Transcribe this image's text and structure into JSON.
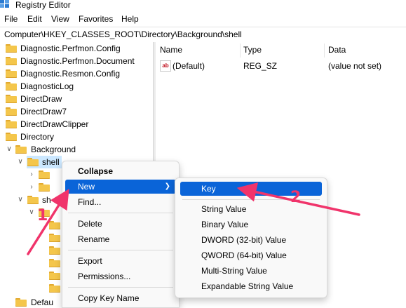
{
  "window": {
    "title": "Registry Editor"
  },
  "menubar": {
    "items": [
      "File",
      "Edit",
      "View",
      "Favorites",
      "Help"
    ]
  },
  "address": {
    "path": "Computer\\HKEY_CLASSES_ROOT\\Directory\\Background\\shell"
  },
  "tree": {
    "items": [
      {
        "label": "Diagnostic.Perfmon.Config"
      },
      {
        "label": "Diagnostic.Perfmon.Document"
      },
      {
        "label": "Diagnostic.Resmon.Config"
      },
      {
        "label": "DiagnosticLog"
      },
      {
        "label": "DirectDraw"
      },
      {
        "label": "DirectDraw7"
      },
      {
        "label": "DirectDrawClipper"
      },
      {
        "label": "Directory"
      },
      {
        "label": "Background"
      },
      {
        "label": "shell"
      },
      {
        "label": "sh"
      },
      {
        "label": "Defau"
      }
    ]
  },
  "list": {
    "columns": [
      "Name",
      "Type",
      "Data"
    ],
    "rows": [
      {
        "icon": "ab",
        "name": "(Default)",
        "type": "REG_SZ",
        "data": "(value not set)"
      }
    ]
  },
  "context_menu": {
    "items": [
      {
        "label": "Collapse"
      },
      {
        "label": "New"
      },
      {
        "label": "Find..."
      },
      {
        "label": "Delete"
      },
      {
        "label": "Rename"
      },
      {
        "label": "Export"
      },
      {
        "label": "Permissions..."
      },
      {
        "label": "Copy Key Name"
      }
    ]
  },
  "submenu": {
    "items": [
      {
        "label": "Key"
      },
      {
        "label": "String Value"
      },
      {
        "label": "Binary Value"
      },
      {
        "label": "DWORD (32-bit) Value"
      },
      {
        "label": "QWORD (64-bit) Value"
      },
      {
        "label": "Multi-String Value"
      },
      {
        "label": "Expandable String Value"
      }
    ]
  },
  "annotations": {
    "step1": "1",
    "step2": "2"
  },
  "colors": {
    "highlight": "#0a64d8",
    "folder": "#f4c64b",
    "annotation": "#f0346b",
    "tree_selection": "#cce8ff"
  }
}
